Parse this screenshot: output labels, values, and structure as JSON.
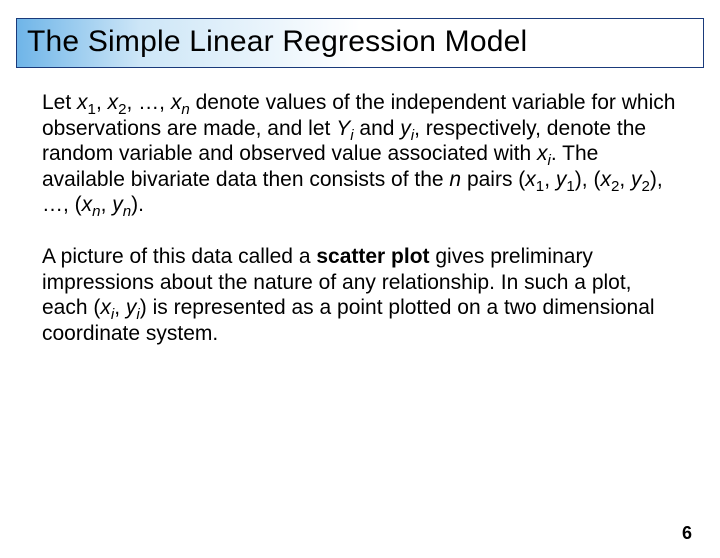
{
  "title": "The Simple Linear Regression Model",
  "paragraph1_html": "Let <i>x</i><sub>1</sub>, <i>x</i><sub>2</sub>, …, <i>x</i><sub><i>n</i></sub> denote values of the independent variable for which observations are made, and let <i>Y<sub>i</sub></i> and <i>y<sub>i</sub></i>, respectively, denote the random variable and observed value associated with <i>x<sub>i</sub></i>. The available bivariate data then consists of the <i>n</i> pairs (<i>x</i><sub>1</sub>, <i>y</i><sub>1</sub>), (<i>x</i><sub>2</sub>, <i>y</i><sub>2</sub>), …, (<i>x</i><sub><i>n</i></sub>, <i>y</i><sub><i>n</i></sub>).",
  "paragraph2_html": "A picture of this data called a <b>scatter plot</b> gives preliminary impressions about the nature of any relationship. In such a plot, each (<i>x<sub>i</sub></i>, <i>y<sub>i</sub></i>) is represented as a point plotted on a two dimensional coordinate system.",
  "page_number": "6"
}
